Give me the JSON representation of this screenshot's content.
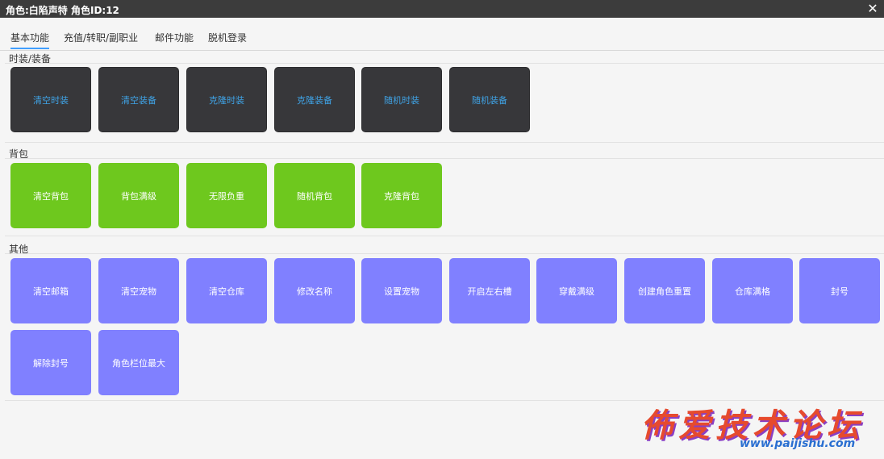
{
  "window": {
    "title": "角色:白陷声特 角色ID:12",
    "close_glyph": "✕"
  },
  "tabs": [
    {
      "label": "基本功能",
      "active": true
    },
    {
      "label": "充值/转职/副职业",
      "active": false
    },
    {
      "label": "邮件功能",
      "active": false
    },
    {
      "label": "脱机登录",
      "active": false
    }
  ],
  "sections": {
    "costume": {
      "label": "时装/装备",
      "buttons": [
        "清空时装",
        "清空装备",
        "克隆时装",
        "克隆装备",
        "随机时装",
        "随机装备"
      ]
    },
    "bag": {
      "label": "背包",
      "buttons": [
        "清空背包",
        "背包满级",
        "无限负重",
        "随机背包",
        "克隆背包"
      ]
    },
    "other": {
      "label": "其他",
      "buttons": [
        "清空邮箱",
        "清空宠物",
        "清空仓库",
        "修改名称",
        "设置宠物",
        "开启左右槽",
        "穿戴满级",
        "创建角色重置",
        "仓库满格",
        "封号",
        "解除封号",
        "角色栏位最大"
      ]
    }
  },
  "watermark": {
    "text": "佈爱技术论坛",
    "url": "www.paijishu.com"
  },
  "colors": {
    "titlebar": "#3c3c3c",
    "dark_button": "#37373a",
    "dark_button_text": "#3fa3e6",
    "green_button": "#6ec81e",
    "purple_button": "#8080ff",
    "tab_active_underline": "#409eff"
  }
}
